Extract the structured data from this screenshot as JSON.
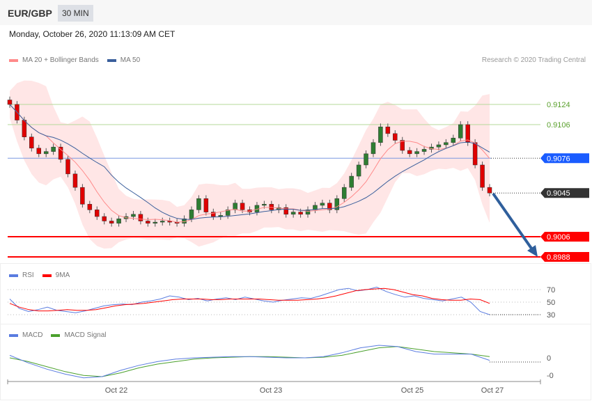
{
  "header": {
    "symbol": "EUR/GBP",
    "timeframe": "30 MIN",
    "datetime": "Monday, October 26, 2020 11:13:09 AM CET"
  },
  "credit": "Research © 2020 Trading Central",
  "colors": {
    "ma20": "#ff8a8a",
    "ma50": "#3a5f9c",
    "bands": "#ffe3e3",
    "resistance": "#5aa02c",
    "pivot": "#1a5cff",
    "last": "#333333",
    "support": "#ff0000",
    "rsi": "#5a7ce0",
    "rsi_ma": "#ff0000",
    "macd": "#5a7ce0",
    "macd_signal": "#4aa02c"
  },
  "chart_data": [
    {
      "type": "candlestick",
      "title": "EUR/GBP 30 MIN",
      "legend": [
        "MA 20 + Bollinger Bands",
        "MA 50"
      ],
      "ylim": [
        0.8975,
        0.9145
      ],
      "closes": [
        0.9124,
        0.911,
        0.9095,
        0.9085,
        0.908,
        0.9082,
        0.9086,
        0.9075,
        0.9062,
        0.905,
        0.9035,
        0.903,
        0.9024,
        0.902,
        0.9018,
        0.9022,
        0.9024,
        0.9026,
        0.902,
        0.9018,
        0.9019,
        0.902,
        0.9019,
        0.9018,
        0.9022,
        0.903,
        0.904,
        0.9028,
        0.9024,
        0.9025,
        0.903,
        0.9036,
        0.903,
        0.9028,
        0.9034,
        0.9035,
        0.903,
        0.9032,
        0.9026,
        0.9028,
        0.9026,
        0.903,
        0.9034,
        0.9036,
        0.903,
        0.904,
        0.905,
        0.906,
        0.907,
        0.908,
        0.909,
        0.9104,
        0.9098,
        0.9092,
        0.9083,
        0.908,
        0.9082,
        0.9084,
        0.9086,
        0.9088,
        0.909,
        0.9094,
        0.9106,
        0.909,
        0.907,
        0.905,
        0.9045
      ],
      "levels": [
        {
          "label": "0.9124",
          "kind": "resistance"
        },
        {
          "label": "0.9106",
          "kind": "resistance"
        },
        {
          "label": "0.9076",
          "kind": "pivot"
        },
        {
          "label": "0.9045",
          "kind": "last"
        },
        {
          "label": "0.9006",
          "kind": "support"
        },
        {
          "label": "0.8988",
          "kind": "support"
        }
      ],
      "levels_value": [
        0.9124,
        0.9106,
        0.9076,
        0.9045,
        0.9006,
        0.8988
      ]
    },
    {
      "type": "line",
      "title": "RSI",
      "legend": [
        "RSI",
        "9MA"
      ],
      "ylim": [
        20,
        80
      ],
      "yticks": [
        "70",
        "50",
        "30"
      ],
      "rsi": [
        55,
        40,
        35,
        38,
        42,
        37,
        35,
        33,
        36,
        40,
        44,
        46,
        47,
        46,
        50,
        52,
        55,
        60,
        58,
        54,
        56,
        52,
        55,
        57,
        54,
        58,
        55,
        52,
        50,
        53,
        55,
        57,
        56,
        60,
        65,
        70,
        72,
        68,
        70,
        74,
        67,
        62,
        58,
        60,
        56,
        54,
        52,
        55,
        58,
        50,
        35,
        30
      ],
      "rsi_ma": [
        48,
        42,
        38,
        36,
        36,
        37,
        38,
        37,
        37,
        38,
        41,
        44,
        46,
        47,
        48,
        50,
        52,
        54,
        55,
        55,
        55,
        54,
        54,
        55,
        55,
        55,
        55,
        54,
        53,
        53,
        53,
        54,
        55,
        57,
        60,
        64,
        68,
        70,
        71,
        72,
        70,
        66,
        62,
        60,
        56,
        54,
        53,
        53,
        55,
        54,
        48
      ]
    },
    {
      "type": "line",
      "title": "MACD",
      "legend": [
        "MACD",
        "MACD Signal"
      ],
      "yticks": [
        "0",
        "-0"
      ],
      "macd": [
        0.2,
        -0.4,
        -0.9,
        -1.3,
        -1.6,
        -1.5,
        -1.0,
        -0.6,
        -0.3,
        -0.1,
        0.0,
        0.05,
        0.1,
        0.1,
        0.05,
        0.0,
        0.0,
        0.1,
        0.4,
        0.8,
        1.0,
        0.9,
        0.5,
        0.3,
        0.3,
        0.3,
        -0.2
      ],
      "signal": [
        0.0,
        -0.3,
        -0.7,
        -1.1,
        -1.4,
        -1.5,
        -1.2,
        -0.8,
        -0.5,
        -0.3,
        -0.1,
        0.0,
        0.05,
        0.1,
        0.1,
        0.05,
        0.0,
        0.05,
        0.2,
        0.5,
        0.8,
        0.9,
        0.7,
        0.5,
        0.4,
        0.3,
        0.1
      ]
    },
    {
      "xticks": [
        "Oct 22",
        "Oct 23",
        "Oct 25",
        "Oct 27"
      ]
    }
  ]
}
